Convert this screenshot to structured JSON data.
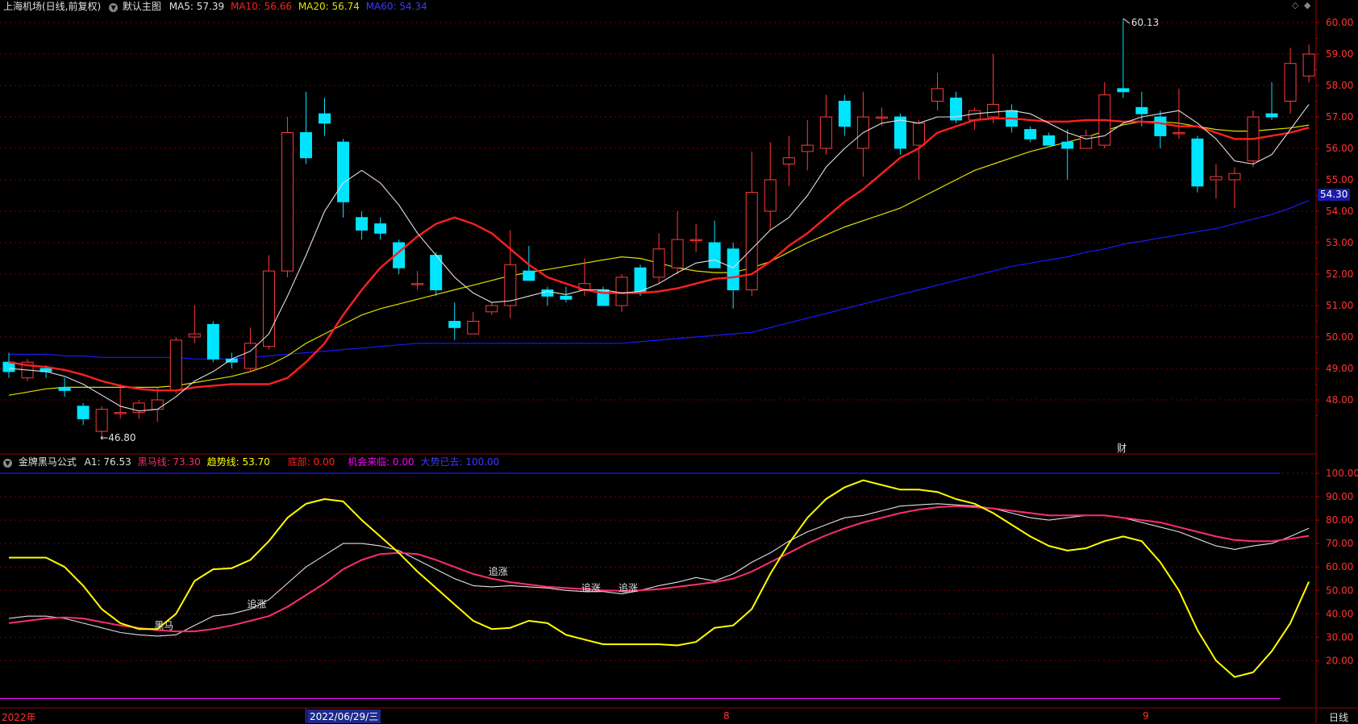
{
  "colors": {
    "background": "#000000",
    "up_candle": "#ff3b3b",
    "down_candle": "#00e5ff",
    "ma5": "#e0e0e0",
    "ma10": "#ff2020",
    "ma20": "#e0e000",
    "ma60": "#1a1aff",
    "grid": "#7a0000",
    "axis_text": "#ff3333",
    "a1": "#e0e0e0",
    "heima": "#ff2d6e",
    "trend": "#ffff00",
    "diku": "#ff2020",
    "chance": "#ff00ff",
    "bull": "#1a1aff"
  },
  "header": {
    "stock": "上海机场(日线,前复权)",
    "main_chart_label": "默认主图",
    "ma5": "MA5: 57.39",
    "ma10": "MA10: 56.66",
    "ma20": "MA20: 56.74",
    "ma60": "MA60: 54.34"
  },
  "indicator_header": {
    "name": "金牌黑马公式",
    "a1": "A1: 76.53",
    "heima": "黑马线: 73.30",
    "trend": "趋势线: 53.70",
    "diku": "底部: 0.00",
    "chance": "机会来临: 0.00",
    "bull": "大势已去: 100.00"
  },
  "annotations": {
    "high": "60.13",
    "low": "←46.80",
    "cai": "财",
    "price_tag": "54.30",
    "signals": [
      "黑马",
      "追涨",
      "追涨",
      "追涨",
      "追涨"
    ]
  },
  "bottom_bar": {
    "year": "2022年",
    "date": "2022/06/29/三",
    "m8": "8",
    "m9": "9",
    "period": "日线"
  },
  "chart_data": [
    {
      "type": "candlestick",
      "title": "上海机场(日线,前复权)",
      "y_ticks": [
        48.0,
        49.0,
        50.0,
        51.0,
        52.0,
        53.0,
        54.0,
        55.0,
        56.0,
        57.0,
        58.0,
        59.0,
        60.0
      ],
      "ylim": [
        46.6,
        60.7
      ],
      "candles": [
        {
          "o": 49.2,
          "h": 49.5,
          "l": 48.7,
          "c": 48.9
        },
        {
          "o": 48.7,
          "h": 49.3,
          "l": 48.6,
          "c": 49.2
        },
        {
          "o": 49.0,
          "h": 49.1,
          "l": 48.7,
          "c": 48.9
        },
        {
          "o": 48.4,
          "h": 48.7,
          "l": 48.1,
          "c": 48.3
        },
        {
          "o": 47.8,
          "h": 47.9,
          "l": 47.2,
          "c": 47.4
        },
        {
          "o": 47.0,
          "h": 47.8,
          "l": 46.8,
          "c": 47.7
        },
        {
          "o": 47.6,
          "h": 48.5,
          "l": 47.4,
          "c": 47.6
        },
        {
          "o": 47.6,
          "h": 48.0,
          "l": 47.4,
          "c": 47.9
        },
        {
          "o": 47.7,
          "h": 48.4,
          "l": 47.3,
          "c": 48.0
        },
        {
          "o": 48.3,
          "h": 50.0,
          "l": 48.2,
          "c": 49.9
        },
        {
          "o": 50.0,
          "h": 51.0,
          "l": 49.8,
          "c": 50.1
        },
        {
          "o": 50.4,
          "h": 50.5,
          "l": 49.2,
          "c": 49.3
        },
        {
          "o": 49.3,
          "h": 49.5,
          "l": 49.0,
          "c": 49.2
        },
        {
          "o": 49.0,
          "h": 50.3,
          "l": 48.9,
          "c": 49.8
        },
        {
          "o": 49.7,
          "h": 52.6,
          "l": 49.6,
          "c": 52.1
        },
        {
          "o": 52.1,
          "h": 57.0,
          "l": 51.9,
          "c": 56.5
        },
        {
          "o": 56.5,
          "h": 57.8,
          "l": 55.5,
          "c": 55.7
        },
        {
          "o": 57.1,
          "h": 57.6,
          "l": 56.4,
          "c": 56.8
        },
        {
          "o": 56.2,
          "h": 56.3,
          "l": 53.8,
          "c": 54.3
        },
        {
          "o": 53.8,
          "h": 54.0,
          "l": 53.1,
          "c": 53.4
        },
        {
          "o": 53.6,
          "h": 53.8,
          "l": 53.1,
          "c": 53.3
        },
        {
          "o": 53.0,
          "h": 53.1,
          "l": 52.0,
          "c": 52.2
        },
        {
          "o": 51.7,
          "h": 52.1,
          "l": 51.5,
          "c": 51.7
        },
        {
          "o": 52.6,
          "h": 52.7,
          "l": 51.3,
          "c": 51.5
        },
        {
          "o": 50.5,
          "h": 51.1,
          "l": 49.9,
          "c": 50.3
        },
        {
          "o": 50.1,
          "h": 50.8,
          "l": 50.1,
          "c": 50.5
        },
        {
          "o": 50.8,
          "h": 51.1,
          "l": 50.7,
          "c": 51.0
        },
        {
          "o": 51.0,
          "h": 53.4,
          "l": 50.6,
          "c": 52.3
        },
        {
          "o": 52.1,
          "h": 52.9,
          "l": 51.8,
          "c": 51.8
        },
        {
          "o": 51.5,
          "h": 51.6,
          "l": 51.0,
          "c": 51.3
        },
        {
          "o": 51.3,
          "h": 51.6,
          "l": 51.1,
          "c": 51.2
        },
        {
          "o": 51.5,
          "h": 52.5,
          "l": 51.3,
          "c": 51.7
        },
        {
          "o": 51.5,
          "h": 51.6,
          "l": 51.0,
          "c": 51.0
        },
        {
          "o": 51.0,
          "h": 52.0,
          "l": 50.8,
          "c": 51.9
        },
        {
          "o": 52.2,
          "h": 52.3,
          "l": 51.3,
          "c": 51.4
        },
        {
          "o": 51.9,
          "h": 53.3,
          "l": 51.7,
          "c": 52.8
        },
        {
          "o": 52.2,
          "h": 54.0,
          "l": 52.0,
          "c": 53.1
        },
        {
          "o": 53.1,
          "h": 53.6,
          "l": 52.7,
          "c": 53.1
        },
        {
          "o": 53.0,
          "h": 53.7,
          "l": 52.6,
          "c": 52.2
        },
        {
          "o": 52.8,
          "h": 53.0,
          "l": 50.9,
          "c": 51.5
        },
        {
          "o": 51.5,
          "h": 55.9,
          "l": 51.3,
          "c": 54.6
        },
        {
          "o": 54.0,
          "h": 56.2,
          "l": 53.4,
          "c": 55.0
        },
        {
          "o": 55.5,
          "h": 56.4,
          "l": 54.8,
          "c": 55.7
        },
        {
          "o": 55.9,
          "h": 56.9,
          "l": 55.3,
          "c": 56.1
        },
        {
          "o": 56.0,
          "h": 57.7,
          "l": 55.8,
          "c": 57.0
        },
        {
          "o": 57.5,
          "h": 57.7,
          "l": 56.4,
          "c": 56.7
        },
        {
          "o": 56.0,
          "h": 57.8,
          "l": 55.1,
          "c": 57.0
        },
        {
          "o": 57.0,
          "h": 57.3,
          "l": 56.7,
          "c": 57.0
        },
        {
          "o": 57.0,
          "h": 57.1,
          "l": 55.8,
          "c": 56.0
        },
        {
          "o": 56.1,
          "h": 56.9,
          "l": 55.0,
          "c": 56.8
        },
        {
          "o": 57.5,
          "h": 58.4,
          "l": 57.2,
          "c": 57.9
        },
        {
          "o": 57.6,
          "h": 57.8,
          "l": 56.8,
          "c": 56.9
        },
        {
          "o": 56.9,
          "h": 57.3,
          "l": 56.6,
          "c": 57.2
        },
        {
          "o": 57.0,
          "h": 59.0,
          "l": 56.8,
          "c": 57.4
        },
        {
          "o": 57.2,
          "h": 57.4,
          "l": 56.5,
          "c": 56.7
        },
        {
          "o": 56.6,
          "h": 56.7,
          "l": 56.2,
          "c": 56.3
        },
        {
          "o": 56.4,
          "h": 56.5,
          "l": 56.1,
          "c": 56.1
        },
        {
          "o": 56.2,
          "h": 56.6,
          "l": 55.0,
          "c": 56.0
        },
        {
          "o": 56.0,
          "h": 56.6,
          "l": 56.0,
          "c": 56.4
        },
        {
          "o": 56.1,
          "h": 58.1,
          "l": 56.0,
          "c": 57.7
        },
        {
          "o": 57.9,
          "h": 60.1,
          "l": 57.6,
          "c": 57.8
        },
        {
          "o": 57.3,
          "h": 57.8,
          "l": 56.7,
          "c": 57.1
        },
        {
          "o": 57.0,
          "h": 57.2,
          "l": 56.0,
          "c": 56.4
        },
        {
          "o": 56.5,
          "h": 57.9,
          "l": 56.3,
          "c": 56.5
        },
        {
          "o": 56.3,
          "h": 56.4,
          "l": 54.6,
          "c": 54.8
        },
        {
          "o": 55.0,
          "h": 55.5,
          "l": 54.4,
          "c": 55.1
        },
        {
          "o": 55.0,
          "h": 55.4,
          "l": 54.1,
          "c": 55.2
        },
        {
          "o": 55.6,
          "h": 57.2,
          "l": 55.4,
          "c": 57.0
        },
        {
          "o": 57.1,
          "h": 58.1,
          "l": 56.9,
          "c": 57.0
        },
        {
          "o": 57.5,
          "h": 59.2,
          "l": 57.1,
          "c": 58.7
        },
        {
          "o": 58.3,
          "h": 59.3,
          "l": 58.1,
          "c": 59.0
        }
      ],
      "series": [
        {
          "name": "MA5",
          "values": [
            49.0,
            48.95,
            48.9,
            48.75,
            48.5,
            48.15,
            47.8,
            47.65,
            47.7,
            48.1,
            48.6,
            48.9,
            49.3,
            49.55,
            50.1,
            51.3,
            52.6,
            54.0,
            54.9,
            55.3,
            54.9,
            54.2,
            53.3,
            52.6,
            51.9,
            51.4,
            51.1,
            51.15,
            51.3,
            51.45,
            51.35,
            51.5,
            51.5,
            51.4,
            51.45,
            51.7,
            52.05,
            52.35,
            52.45,
            52.2,
            52.8,
            53.4,
            53.8,
            54.5,
            55.4,
            56.0,
            56.5,
            56.8,
            56.9,
            56.8,
            57.0,
            57.0,
            57.1,
            57.15,
            57.2,
            57.1,
            56.8,
            56.5,
            56.3,
            56.4,
            56.8,
            57.0,
            57.1,
            57.2,
            56.8,
            56.3,
            55.6,
            55.5,
            55.8,
            56.6,
            57.4
          ]
        },
        {
          "name": "MA10",
          "values": [
            49.2,
            49.1,
            49.05,
            48.95,
            48.8,
            48.6,
            48.45,
            48.35,
            48.3,
            48.3,
            48.4,
            48.45,
            48.5,
            48.5,
            48.5,
            48.7,
            49.2,
            49.8,
            50.7,
            51.5,
            52.2,
            52.7,
            53.2,
            53.6,
            53.8,
            53.6,
            53.3,
            52.8,
            52.3,
            51.9,
            51.7,
            51.5,
            51.4,
            51.4,
            51.4,
            51.45,
            51.55,
            51.7,
            51.85,
            51.9,
            52.0,
            52.4,
            52.9,
            53.3,
            53.8,
            54.3,
            54.7,
            55.2,
            55.7,
            56.0,
            56.5,
            56.7,
            56.9,
            56.95,
            56.95,
            56.9,
            56.85,
            56.85,
            56.9,
            56.9,
            56.85,
            56.85,
            56.8,
            56.7,
            56.7,
            56.5,
            56.3,
            56.3,
            56.4,
            56.5,
            56.66
          ]
        },
        {
          "name": "MA20",
          "values": [
            48.15,
            48.25,
            48.35,
            48.4,
            48.4,
            48.4,
            48.4,
            48.4,
            48.4,
            48.45,
            48.55,
            48.65,
            48.75,
            48.9,
            49.1,
            49.4,
            49.8,
            50.1,
            50.4,
            50.7,
            50.9,
            51.05,
            51.2,
            51.35,
            51.5,
            51.65,
            51.8,
            51.95,
            52.05,
            52.15,
            52.25,
            52.35,
            52.45,
            52.55,
            52.5,
            52.35,
            52.2,
            52.1,
            52.05,
            52.05,
            52.2,
            52.4,
            52.7,
            53.0,
            53.25,
            53.5,
            53.7,
            53.9,
            54.1,
            54.4,
            54.7,
            55.0,
            55.3,
            55.5,
            55.7,
            55.9,
            56.05,
            56.2,
            56.35,
            56.55,
            56.75,
            56.85,
            56.85,
            56.8,
            56.7,
            56.6,
            56.55,
            56.55,
            56.6,
            56.65,
            56.74
          ]
        },
        {
          "name": "MA60",
          "values": [
            49.45,
            49.45,
            49.45,
            49.4,
            49.4,
            49.35,
            49.35,
            49.35,
            49.35,
            49.35,
            49.3,
            49.3,
            49.3,
            49.35,
            49.4,
            49.45,
            49.5,
            49.55,
            49.6,
            49.65,
            49.7,
            49.75,
            49.8,
            49.8,
            49.8,
            49.8,
            49.8,
            49.8,
            49.8,
            49.8,
            49.8,
            49.8,
            49.8,
            49.8,
            49.85,
            49.9,
            49.95,
            50.0,
            50.05,
            50.1,
            50.15,
            50.3,
            50.45,
            50.6,
            50.75,
            50.9,
            51.05,
            51.2,
            51.35,
            51.5,
            51.65,
            51.8,
            51.95,
            52.1,
            52.25,
            52.35,
            52.45,
            52.55,
            52.7,
            52.8,
            52.95,
            53.05,
            53.15,
            53.25,
            53.35,
            53.45,
            53.6,
            53.75,
            53.9,
            54.1,
            54.34
          ]
        }
      ],
      "annotations": [
        "60.13",
        "←46.80",
        "54.30"
      ]
    },
    {
      "type": "line",
      "title": "金牌黑马公式",
      "y_ticks": [
        20.0,
        30.0,
        40.0,
        50.0,
        60.0,
        70.0,
        80.0,
        90.0,
        100.0
      ],
      "ylim": [
        2,
        103
      ],
      "series": [
        {
          "name": "A1",
          "values": [
            38,
            39,
            39,
            38,
            36,
            34,
            32,
            31,
            30.5,
            31,
            35,
            39,
            40,
            42,
            46,
            53,
            60,
            65,
            70,
            70,
            69,
            67,
            63,
            59,
            55,
            52,
            51.5,
            52,
            51.5,
            51,
            50,
            49.5,
            49.5,
            48.5,
            50,
            52,
            53.5,
            55.5,
            54,
            57,
            62,
            66,
            71,
            75,
            78,
            81,
            82,
            84,
            86,
            86.5,
            87,
            86.5,
            86,
            85,
            83,
            81,
            80,
            81,
            82,
            82,
            81,
            79,
            77,
            75,
            72,
            69,
            67.5,
            69,
            70,
            73,
            76.53
          ]
        },
        {
          "name": "黑马线",
          "values": [
            36,
            37,
            38,
            38.5,
            38,
            36.5,
            35,
            34,
            33,
            32.5,
            32.5,
            33.5,
            35,
            37,
            39,
            43,
            48,
            53,
            59,
            63,
            65.5,
            66,
            65.5,
            63,
            60,
            57,
            55,
            53.5,
            52.5,
            51.5,
            51,
            50.5,
            50,
            49.8,
            50,
            50.5,
            51.5,
            52.5,
            53.5,
            55,
            58,
            62,
            66,
            70,
            73.5,
            76.5,
            79,
            81,
            83,
            84.5,
            85.5,
            86,
            85.5,
            85,
            84,
            83,
            82,
            82,
            82,
            82,
            81,
            80,
            79,
            77,
            75,
            73,
            71.5,
            71,
            71,
            72,
            73.3
          ]
        },
        {
          "name": "趋势线",
          "values": [
            64,
            64,
            64,
            60,
            52,
            42,
            36,
            33.5,
            33.5,
            40,
            54,
            59,
            59.5,
            63,
            71,
            81,
            87,
            89,
            88,
            80,
            73,
            66,
            58,
            51,
            44,
            37,
            33.5,
            34,
            37,
            36,
            31,
            29,
            27,
            27,
            27,
            27,
            26.5,
            28,
            34,
            35,
            42,
            57,
            70,
            81,
            89,
            94,
            97,
            95,
            93,
            93,
            92,
            89,
            87,
            83,
            78,
            73,
            69,
            67,
            68,
            71,
            73,
            71,
            62,
            50,
            33,
            20,
            13,
            15,
            24,
            36,
            53.7
          ]
        },
        {
          "name": "底部",
          "values": [
            3.8,
            3.8
          ]
        },
        {
          "name": "机会来临",
          "values": [
            3.8,
            3.8
          ]
        },
        {
          "name": "大势已去",
          "values": [
            100,
            100
          ]
        }
      ],
      "annotations": [
        "黑马",
        "追涨",
        "追涨",
        "追涨",
        "追涨"
      ]
    }
  ]
}
